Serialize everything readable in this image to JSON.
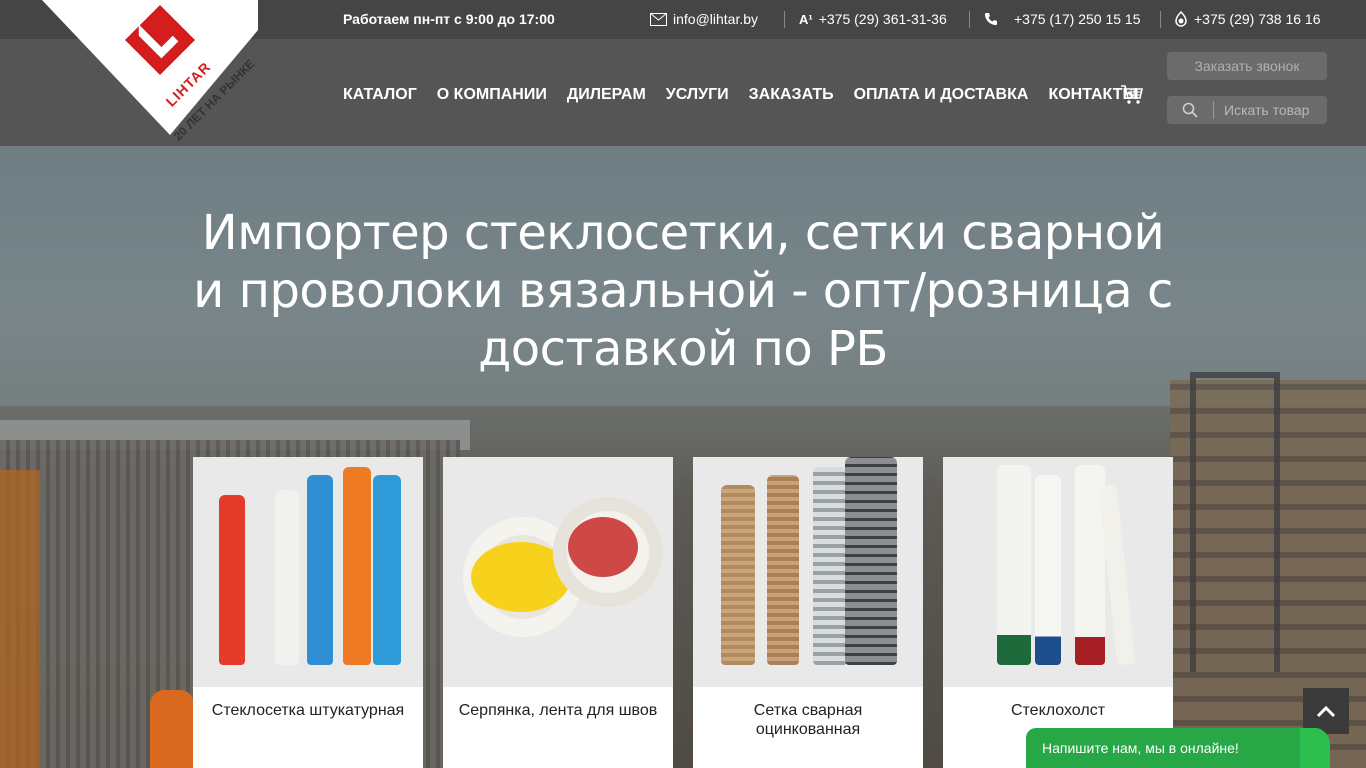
{
  "topbar": {
    "hours": "Работаем пн-пт с 9:00 до 17:00",
    "email": "info@lihtar.by",
    "phone_a1": "+375 (29) 361-31-36",
    "phone_city": "+375 (17) 250 15 15",
    "phone_mts": "+375 (29) 738 16 16"
  },
  "logo": {
    "brand": "LIHTAR",
    "tagline": "20 ЛЕТ НА РЫНКЕ"
  },
  "nav": {
    "items": [
      "КАТАЛОГ",
      "О КОМПАНИИ",
      "ДИЛЕРАМ",
      "УСЛУГИ",
      "ЗАКАЗАТЬ",
      "ОПЛАТА И ДОСТАВКА",
      "КОНТАКТЫ"
    ],
    "call_button": "Заказать звонок",
    "search_placeholder": "Искать товар"
  },
  "hero": {
    "headline": "Импортер стеклосетки, сетки сварной и проволоки вязальной - опт/розница с доставкой по РБ"
  },
  "products": [
    {
      "label": "Стеклосетка штукатурная"
    },
    {
      "label": "Серпянка, лента для швов"
    },
    {
      "label": "Сетка сварная оцинкованная"
    },
    {
      "label": "Стеклохолст"
    }
  ],
  "chat": {
    "text": "Напишите нам, мы в онлайне!"
  },
  "colors": {
    "brand_red": "#d41e1e",
    "header_dark": "#454545",
    "nav_bg": "#555555",
    "chat_green": "#27a745"
  }
}
